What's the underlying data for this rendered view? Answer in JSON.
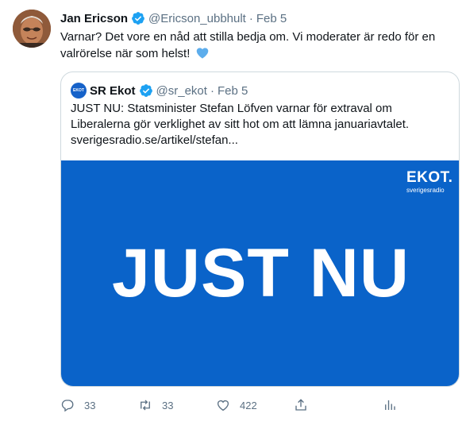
{
  "tweet": {
    "author_name": "Jan Ericson",
    "author_handle": "@Ericson_ubbhult",
    "separator": "·",
    "date": "Feb 5",
    "text": "Varnar? Det vore en nåd att stilla bedja om. Vi moderater är redo för en valrörelse när som helst!",
    "more_icon": "more-icon",
    "verified_icon": "verified-icon"
  },
  "quote": {
    "author_name": "SR Ekot",
    "author_handle": "@sr_ekot",
    "separator": "·",
    "date": "Feb 5",
    "avatar_text": "EKOT",
    "text": "JUST NU: Statsminister Stefan Löfven varnar för extraval om Liberalerna gör verklighet av sitt hot om att lämna januariavtalet.",
    "link": "sverigesradio.se/artikel/stefan...",
    "media": {
      "logo_word": "EKOT.",
      "logo_sub": "sverigesradio",
      "headline": "JUST NU",
      "background": "#0a63c9"
    }
  },
  "actions": {
    "reply_count": "33",
    "retweet_count": "33",
    "like_count": "422"
  },
  "colors": {
    "verified": "#1da1f2",
    "secondary_text": "#5b7083",
    "heart_emoji": "#5dadec"
  }
}
